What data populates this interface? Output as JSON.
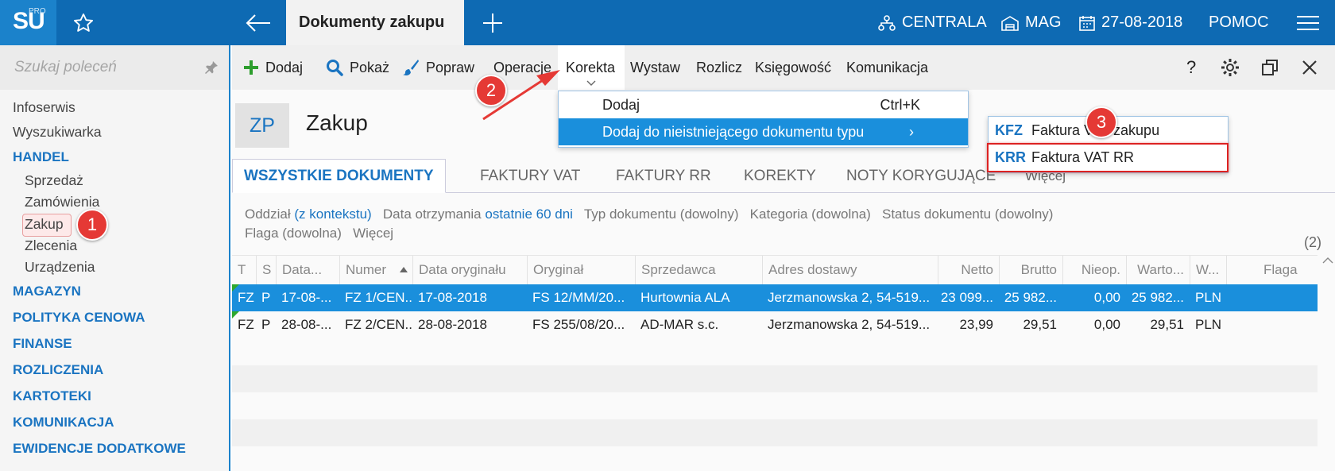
{
  "app": {
    "logo_text": "SU",
    "logo_sup": "PRO",
    "active_tab": "Dokumenty zakupu",
    "centrala": "CENTRALA",
    "magazyn": "MAG",
    "date": "27-08-2018",
    "help": "POMOC"
  },
  "sidebar": {
    "search_placeholder": "Szukaj poleceń",
    "items": [
      {
        "label": "Infoserwis"
      },
      {
        "label": "Wyszukiwarka"
      },
      {
        "label": "HANDEL"
      },
      {
        "label": "Sprzedaż"
      },
      {
        "label": "Zamówienia"
      },
      {
        "label": "Zakup"
      },
      {
        "label": "Zlecenia"
      },
      {
        "label": "Urządzenia"
      },
      {
        "label": "MAGAZYN"
      },
      {
        "label": "POLITYKA CENOWA"
      },
      {
        "label": "FINANSE"
      },
      {
        "label": "ROZLICZENIA"
      },
      {
        "label": "KARTOTEKI"
      },
      {
        "label": "KOMUNIKACJA"
      },
      {
        "label": "EWIDENCJE DODATKOWE"
      }
    ]
  },
  "toolbar": {
    "dodaj": "Dodaj",
    "pokaz": "Pokaż",
    "popraw": "Popraw",
    "operacje": "Operacje",
    "korekta": "Korekta",
    "wystaw": "Wystaw",
    "rozlicz": "Rozlicz",
    "ksiegowosc": "Księgowość",
    "komunikacja": "Komunikacja",
    "help": "?"
  },
  "page": {
    "code": "ZP",
    "title": "Zakup"
  },
  "tabs": [
    "WSZYSTKIE DOKUMENTY",
    "FAKTURY VAT",
    "FAKTURY RR",
    "KOREKTY",
    "NOTY KORYGUJĄCE",
    "Więcej"
  ],
  "filters": {
    "oddzial_label": "Oddział",
    "oddzial_value": "(z kontekstu)",
    "data_label": "Data otrzymania",
    "data_value": "ostatnie 60 dni",
    "typ": "Typ dokumentu (dowolny)",
    "kategoria": "Kategoria (dowolna)",
    "status": "Status dokumentu (dowolny)",
    "flaga": "Flaga (dowolna)",
    "wiecej": "Więcej",
    "count": "(2)"
  },
  "grid": {
    "columns": [
      "T",
      "S",
      "Data...",
      "Numer",
      "Data oryginału",
      "Oryginał",
      "Sprzedawca",
      "Adres dostawy",
      "Netto",
      "Brutto",
      "Nieop.",
      "Warto...",
      "W...",
      "Flaga"
    ],
    "rows": [
      [
        "FZ",
        "P",
        "17-08-...",
        "FZ 1/CEN...",
        "17-08-2018",
        "FS 12/MM/20...",
        "Hurtownia ALA",
        "Jerzmanowska 2, 54-519...",
        "23 099...",
        "25 982...",
        "0,00",
        "25 982...",
        "PLN",
        ""
      ],
      [
        "FZ",
        "P",
        "28-08-...",
        "FZ 2/CEN...",
        "28-08-2018",
        "FS 255/08/20...",
        "AD-MAR s.c.",
        "Jerzmanowska 2, 54-519...",
        "23,99",
        "29,51",
        "0,00",
        "29,51",
        "PLN",
        ""
      ]
    ]
  },
  "menu": {
    "item1": "Dodaj",
    "item1_shortcut": "Ctrl+K",
    "item2": "Dodaj do nieistniejącego dokumentu typu",
    "item2_arrow": "›"
  },
  "submenu": {
    "items": [
      {
        "code": "KFZ",
        "label": "Faktura VAT zakupu"
      },
      {
        "code": "KRR",
        "label": "Faktura VAT RR"
      }
    ]
  },
  "callouts": [
    "1",
    "2",
    "3"
  ],
  "colors": {
    "topbar": "#0e6ab3",
    "accent": "#1a8fdc",
    "callout": "#e53935"
  }
}
